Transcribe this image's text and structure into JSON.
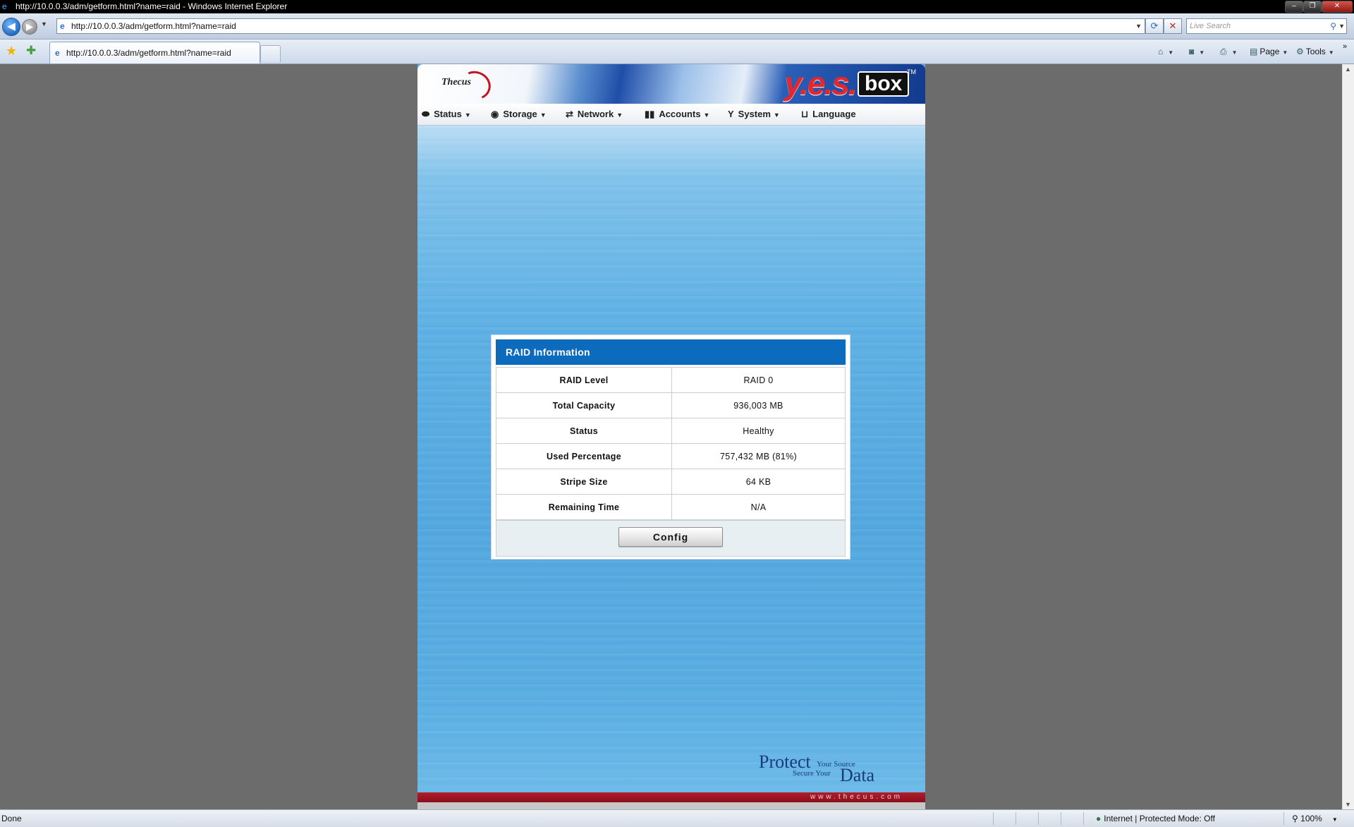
{
  "window": {
    "title": "http://10.0.0.3/adm/getform.html?name=raid - Windows Internet Explorer",
    "controls": {
      "minimize": "–",
      "restore": "❐",
      "close": "✕"
    }
  },
  "address_bar": {
    "url": "http://10.0.0.3/adm/getform.html?name=raid",
    "search_placeholder": "Live Search"
  },
  "tabs": [
    {
      "label": "http://10.0.0.3/adm/getform.html?name=raid",
      "active": true
    }
  ],
  "command_bar": {
    "page_label": "Page",
    "tools_label": "Tools"
  },
  "app": {
    "brand_left": "Thecus",
    "brand_right_yes": "y.e.s.",
    "brand_right_box": "box",
    "brand_tm": "TM",
    "menu": [
      {
        "label": "Status",
        "icon": "status-icon"
      },
      {
        "label": "Storage",
        "icon": "storage-icon"
      },
      {
        "label": "Network",
        "icon": "network-icon"
      },
      {
        "label": "Accounts",
        "icon": "accounts-icon"
      },
      {
        "label": "System",
        "icon": "system-icon"
      },
      {
        "label": "Language",
        "icon": "language-icon"
      }
    ],
    "raid_panel": {
      "title": "RAID Information",
      "rows": [
        {
          "label": "RAID Level",
          "value": "RAID 0"
        },
        {
          "label": "Total Capacity",
          "value": "936,003 MB"
        },
        {
          "label": "Status",
          "value": "Healthy"
        },
        {
          "label": "Used Percentage",
          "value": "757,432 MB (81%)"
        },
        {
          "label": "Stripe Size",
          "value": "64 KB"
        },
        {
          "label": "Remaining Time",
          "value": "N/A"
        }
      ],
      "config_button": "Config"
    },
    "slogan": {
      "protect": "Protect",
      "your_source": "Your Source",
      "secure_your": "Secure Your",
      "data": "Data"
    },
    "footer_url": "www.thecus.com"
  },
  "status_bar": {
    "status": "Done",
    "zone": "Internet | Protected Mode: Off",
    "zoom": "100%"
  },
  "colors": {
    "panel_header": "#0d6bbd",
    "footer_red": "#a0162a",
    "page_bg": "#6c6c6c"
  }
}
